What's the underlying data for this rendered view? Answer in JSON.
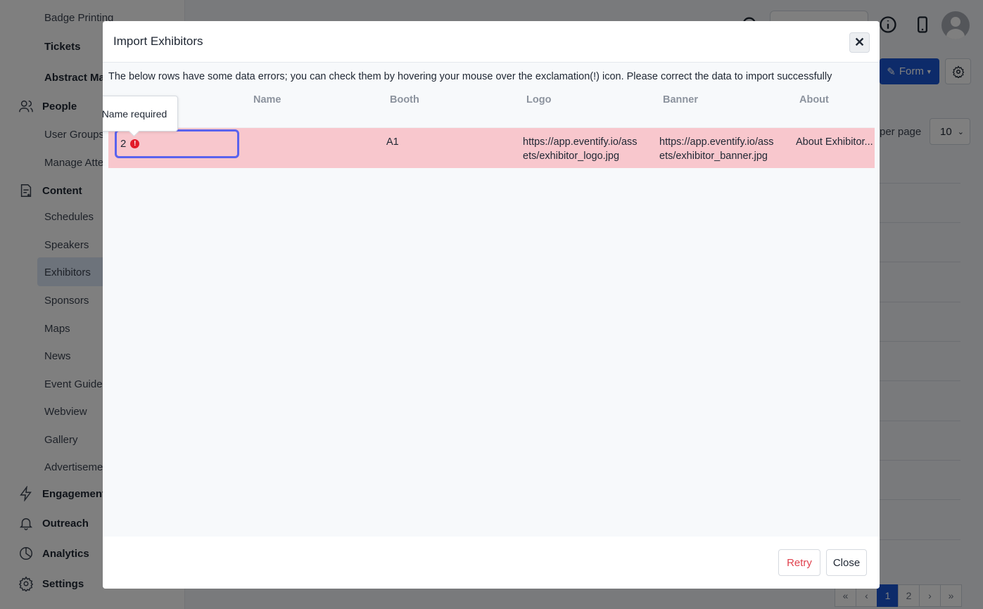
{
  "sidebar": {
    "badge_printing": "Badge Printing",
    "tickets": "Tickets",
    "abstract": "Abstract Ma",
    "people": "People",
    "user_groups": "User Groups",
    "manage_attendees": "Manage Atte",
    "content": "Content",
    "schedules": "Schedules",
    "speakers": "Speakers",
    "exhibitors": "Exhibitors",
    "sponsors": "Sponsors",
    "maps": "Maps",
    "news": "News",
    "event_guide": "Event Guide",
    "webview": "Webview",
    "gallery": "Gallery",
    "advertisements": "Advertiseme",
    "engagement": "Engagement",
    "outreach": "Outreach",
    "analytics": "Analytics",
    "settings": "Settings"
  },
  "main": {
    "form_button": "Form",
    "per_page_label": "per page",
    "per_page_value": "10",
    "pager": [
      "«",
      "‹",
      "1",
      "2",
      "›",
      "»"
    ]
  },
  "modal": {
    "title": "Import Exhibitors",
    "close_x": "✕",
    "message": "The below rows have some data errors; you can check them by hovering your mouse over the exclamation(!) icon. Please correct the data to import successfully",
    "columns": {
      "name": "Name",
      "booth": "Booth",
      "logo": "Logo",
      "banner": "Banner",
      "about": "About"
    },
    "row": {
      "number": "2",
      "booth": "A1",
      "logo": "https://app.eventify.io/assets/exhibitor_logo.jpg",
      "banner": "https://app.eventify.io/assets/exhibitor_banner.jpg",
      "about": "About Exhibitor..."
    },
    "tooltip": "Name required",
    "retry": "Retry",
    "close": "Close"
  },
  "colors": {
    "accent": "#1b57d4",
    "error_row": "#f8c7cd",
    "focus_border": "#5a63ee",
    "error_icon": "#e21b2a"
  }
}
